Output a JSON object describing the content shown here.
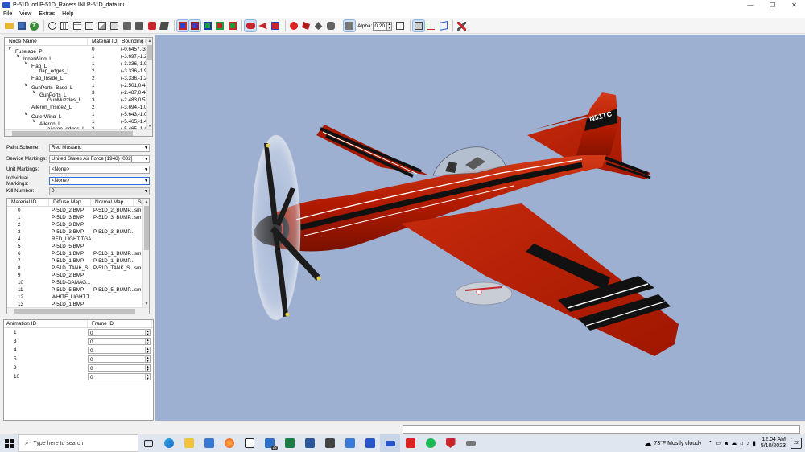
{
  "window": {
    "title": "P-51D.lod  P-51D_Racers.INI  P-51D_data.ini",
    "controls": [
      "—",
      "❐",
      "✕"
    ]
  },
  "menu": [
    "File",
    "View",
    "Extras",
    "Help"
  ],
  "toolbar": {
    "alpha_label": "Alpha:",
    "alpha_value": "0.20"
  },
  "node_tree": {
    "columns": [
      "Node Name",
      "Material ID",
      "Bounding B"
    ],
    "rows": [
      {
        "expander": "∨",
        "name": "Fuselage_P",
        "mat": "0",
        "bb": "(-0.6457,-3.8"
      },
      {
        "expander": "∨",
        "name": "InnerWing_L",
        "mat": "1",
        "bb": "(-3.697,-1.29"
      },
      {
        "expander": "∨",
        "name": "Flap_L",
        "mat": "1",
        "bb": "(-3.336,-1.96"
      },
      {
        "expander": "",
        "name": "flap_edges_L",
        "mat": "2",
        "bb": "(-3.336,-1.96"
      },
      {
        "expander": "",
        "name": "Flap_Inside_L",
        "mat": "2",
        "bb": "(-3.336,-1.29"
      },
      {
        "expander": "∨",
        "name": "GunPorts_Base_L",
        "mat": "1",
        "bb": "(-2.501,0.480"
      },
      {
        "expander": "∨",
        "name": "GunPorts_L",
        "mat": "3",
        "bb": "(-2.487,0.446"
      },
      {
        "expander": "",
        "name": "GunMuzzles_L",
        "mat": "3",
        "bb": "(-2.483,0.579"
      },
      {
        "expander": "",
        "name": "Aileron_Inside2_L",
        "mat": "2",
        "bb": "(-3.694,-1.03"
      },
      {
        "expander": "∨",
        "name": "OuterWing_L",
        "mat": "1",
        "bb": "(-5.643,-1.02"
      },
      {
        "expander": "∨",
        "name": "Aileron_L",
        "mat": "1",
        "bb": "(-5.465,-1.43"
      },
      {
        "expander": "",
        "name": "aileron_edges_L",
        "mat": "2",
        "bb": "(-5.465,-1.43"
      }
    ]
  },
  "fields": {
    "paint_scheme": {
      "label": "Paint Scheme:",
      "value": "Red Mustang"
    },
    "service_markings": {
      "label": "Service Markings:",
      "value": "United States Air Force (1948) [002]"
    },
    "unit_markings": {
      "label": "Unit Markings:",
      "value": "<None>"
    },
    "individual_markings": {
      "label": "Individual Markings:",
      "value": "<None>"
    },
    "kill_number": {
      "label": "Kill Number:",
      "value": "0"
    }
  },
  "materials": {
    "columns": [
      "Material ID",
      "Diffuse Map",
      "Normal Map",
      "Spe"
    ],
    "rows": [
      {
        "id": "0",
        "diffuse": "P-51D_2.BMP",
        "normal": "P-51D_2_BUMP....",
        "spec": "sm"
      },
      {
        "id": "1",
        "diffuse": "P-51D_3.BMP",
        "normal": "P-51D_3_BUMP....",
        "spec": "sm"
      },
      {
        "id": "2",
        "diffuse": "P-51D_3.BMP",
        "normal": "",
        "spec": ""
      },
      {
        "id": "3",
        "diffuse": "P-51D_3.BMP",
        "normal": "P-51D_3_BUMP....",
        "spec": ""
      },
      {
        "id": "4",
        "diffuse": "RED_LIGHT.TGA",
        "normal": "",
        "spec": ""
      },
      {
        "id": "5",
        "diffuse": "P-51D_5.BMP",
        "normal": "",
        "spec": ""
      },
      {
        "id": "6",
        "diffuse": "P-51D_1.BMP",
        "normal": "P-51D_1_BUMP....",
        "spec": "sm"
      },
      {
        "id": "7",
        "diffuse": "P-51D_1.BMP",
        "normal": "P-51D_1_BUMP....",
        "spec": ""
      },
      {
        "id": "8",
        "diffuse": "P-51D_TANK_S...",
        "normal": "P-51D_TANK_S...",
        "spec": "sm"
      },
      {
        "id": "9",
        "diffuse": "P-51D_2.BMP",
        "normal": "",
        "spec": ""
      },
      {
        "id": "10",
        "diffuse": "P-51D-DAMAG...",
        "normal": "",
        "spec": ""
      },
      {
        "id": "11",
        "diffuse": "P-51D_5.BMP",
        "normal": "P-51D_5_BUMP....",
        "spec": "sm"
      },
      {
        "id": "12",
        "diffuse": "WHITE_LIGHT.T...",
        "normal": "",
        "spec": ""
      },
      {
        "id": "13",
        "diffuse": "P-51D_1.BMP",
        "normal": "",
        "spec": ""
      }
    ]
  },
  "animations": {
    "columns": [
      "Animation ID",
      "Frame ID"
    ],
    "rows": [
      {
        "id": "1",
        "frame": "0"
      },
      {
        "id": "3",
        "frame": "0"
      },
      {
        "id": "4",
        "frame": "0"
      },
      {
        "id": "5",
        "frame": "0"
      },
      {
        "id": "9",
        "frame": "0"
      },
      {
        "id": "10",
        "frame": "0"
      }
    ]
  },
  "aircraft": {
    "tail_code": "N51TC",
    "colors": {
      "body": "#b61a00",
      "stripe": "#111111",
      "trim": "#ffffff",
      "background": "#9db0d2"
    }
  },
  "taskbar": {
    "search_placeholder": "Type here to search",
    "weather": "73°F  Mostly cloudy",
    "time": "12:04 AM",
    "date": "5/10/2023",
    "notification_count": "22",
    "mail_badge": "22"
  }
}
